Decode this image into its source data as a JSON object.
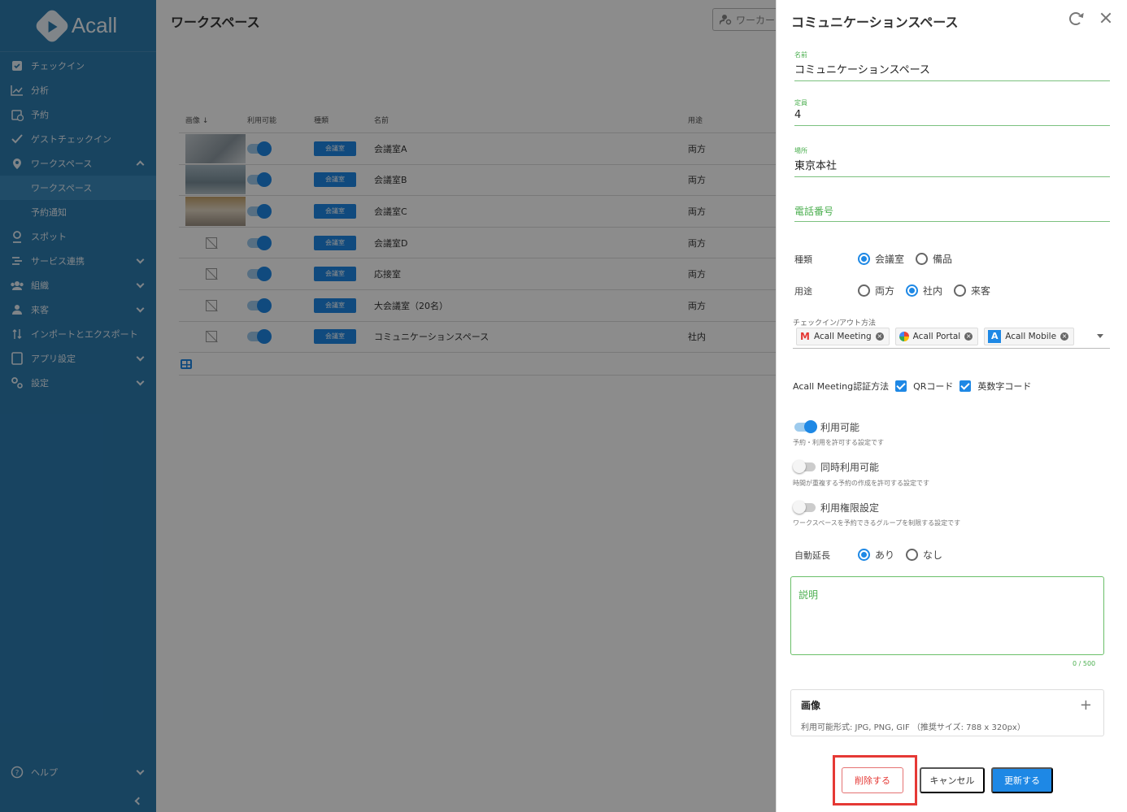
{
  "brand": {
    "name": "Acall"
  },
  "sidebar": {
    "items": [
      {
        "label": "チェックイン",
        "icon": "checkbox-icon"
      },
      {
        "label": "分析",
        "icon": "chart-icon"
      },
      {
        "label": "予約",
        "icon": "calendar-icon"
      },
      {
        "label": "ゲストチェックイン",
        "icon": "check-icon"
      },
      {
        "label": "ワークスペース",
        "icon": "pin-icon"
      },
      {
        "label": "ワークスペース",
        "icon": ""
      },
      {
        "label": "予約通知",
        "icon": ""
      },
      {
        "label": "スポット",
        "icon": "spot-icon"
      },
      {
        "label": "サービス連携",
        "icon": "link-icon"
      },
      {
        "label": "組織",
        "icon": "group-icon"
      },
      {
        "label": "来客",
        "icon": "person-icon"
      },
      {
        "label": "インポートとエクスポート",
        "icon": "import-export-icon"
      },
      {
        "label": "アプリ設定",
        "icon": "tablet-icon"
      },
      {
        "label": "設定",
        "icon": "gear-icon"
      }
    ],
    "help": "ヘルプ"
  },
  "main": {
    "title": "ワークスペース",
    "search_placeholder": "ワーカー",
    "columns": {
      "image": "画像",
      "available": "利用可能",
      "type": "種類",
      "name": "名前",
      "usage": "用途"
    },
    "rows": [
      {
        "type": "会議室",
        "name": "会議室A",
        "usage": "両方"
      },
      {
        "type": "会議室",
        "name": "会議室B",
        "usage": "両方"
      },
      {
        "type": "会議室",
        "name": "会議室C",
        "usage": "両方"
      },
      {
        "type": "会議室",
        "name": "会議室D",
        "usage": "両方"
      },
      {
        "type": "会議室",
        "name": "応接室",
        "usage": "両方"
      },
      {
        "type": "会議室",
        "name": "大会議室（20名）",
        "usage": "両方"
      },
      {
        "type": "会議室",
        "name": "コミュニケーションスペース",
        "usage": "社内"
      }
    ]
  },
  "panel": {
    "title": "コミュニケーションスペース",
    "name_label": "名前",
    "name_value": "コミュニケーションスペース",
    "capacity_label": "定員",
    "capacity_value": "4",
    "location_label": "場所",
    "location_value": "東京本社",
    "phone_label": "電話番号",
    "type_label": "種類",
    "type_options": [
      "会議室",
      "備品"
    ],
    "usage_label": "用途",
    "usage_options": [
      "両方",
      "社内",
      "来客"
    ],
    "checkin_label": "チェックイン/アウト方法",
    "checkin_tags": [
      "Acall Meeting",
      "Acall Portal",
      "Acall Mobile"
    ],
    "auth_label": "Acall Meeting認証方法",
    "auth_qr": "QRコード",
    "auth_alnum": "英数字コード",
    "available_label": "利用可能",
    "available_desc": "予約・利用を許可する設定です",
    "concurrent_label": "同時利用可能",
    "concurrent_desc": "時間が重複する予約の作成を許可する設定です",
    "permission_label": "利用権限設定",
    "permission_desc": "ワークスペースを予約できるグループを制限する設定です",
    "auto_extend_label": "自動延長",
    "auto_extend_options": [
      "あり",
      "なし"
    ],
    "description_label": "説明",
    "description_counter": "0 / 500",
    "image_label": "画像",
    "image_desc": "利用可能形式: JPG, PNG, GIF （推奨サイズ: 788 x 320px）",
    "delete": "削除する",
    "cancel": "キャンセル",
    "update": "更新する"
  }
}
